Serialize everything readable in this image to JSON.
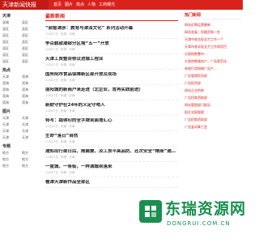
{
  "header": {
    "brand": "天津新闻快报",
    "nav": [
      "首页",
      "图片",
      "热点",
      "人物",
      "工商曝光"
    ]
  },
  "sidebar": {
    "sections": [
      {
        "title": "天津",
        "items": [
          "县城",
          "县区",
          "县区",
          "县区",
          "县区",
          "县区",
          "县区",
          "县区",
          "县区",
          "县区",
          "县区",
          "县区",
          "县区",
          "县区"
        ]
      },
      {
        "title": "热点",
        "items": [
          "天津",
          "滨海",
          "滨海",
          "滨海",
          "滨海",
          "滨海",
          "滨海",
          "滨海",
          "滨海",
          "滨海"
        ]
      },
      {
        "title": "图片",
        "items": [
          "天津",
          "天津",
          "天津",
          "天津",
          "天津",
          "天津",
          "天津",
          "天津"
        ]
      },
      {
        "title": "专题",
        "items": [
          "地方",
          "地方",
          "地方",
          "地方",
          "地方",
          "地方"
        ]
      }
    ]
  },
  "main": {
    "title": "最新新闻",
    "items": [
      {
        "title": "“启智津彦：教育与津派文化” 系列活动开幕",
        "date": "11月27日",
        "source": "来源：天津"
      },
      {
        "title": "李百鹤就潮部分区域“五一”开放",
        "date": "11月27日",
        "source": "来源：天津"
      },
      {
        "title": "天津工贸整合修议进城工程业",
        "date": "11月27日",
        "source": "来源：天津"
      },
      {
        "title": "国务院市食品保障新区部开放及现场",
        "date": "11月27日",
        "source": "来源：天津"
      },
      {
        "title": "南阳城的新商户来走进（北企业，肯再实践前进）",
        "date": "11月27日",
        "source": "来源：天津"
      },
      {
        "title": "新财守护社24年的义定守哨人",
        "date": "11月27日",
        "source": "来源：天津"
      },
      {
        "title": "特写：跑得印的全字牌到面增汇心",
        "date": "11月27日",
        "source": "来源：天津"
      },
      {
        "title": "生命“落日”自然",
        "date": "11月27日",
        "source": "来源：天津"
      },
      {
        "title": "通知出行部日后、随需要、及工良平高品防、还次安全“精商”通知好",
        "date": "11月27日",
        "source": "来源：天津"
      },
      {
        "title": "一度城，一条街，一样满城到落来",
        "date": "11月27日",
        "source": "来源：天津"
      },
      {
        "title": "看津天津新作品全部区",
        "date": "",
        "source": ""
      }
    ]
  },
  "right": {
    "title": "热门新闻",
    "items": [
      "网站近期运营最新",
      "网站发展、投融资和一些",
      "天津市各实现全力工作一个",
      "天津市各实现全力工作和项目",
      "分类地数整市...",
      "分类地数服务户，广告规范化",
      "有效打造网络广告产...",
      "广告管理投资部",
      "广告投资部",
      "网站企业的新",
      "广告招商资助部",
      "网站管理部门报告",
      "报交式报管理",
      "广告招商资助部",
      "广告变动事工会"
    ]
  },
  "watermark": {
    "text": "东瑞资源网",
    "sub": "DONGRUI.COM.CN"
  },
  "colors": {
    "brand_red": "#d9221c",
    "watermark_green": "#1a8f50"
  }
}
